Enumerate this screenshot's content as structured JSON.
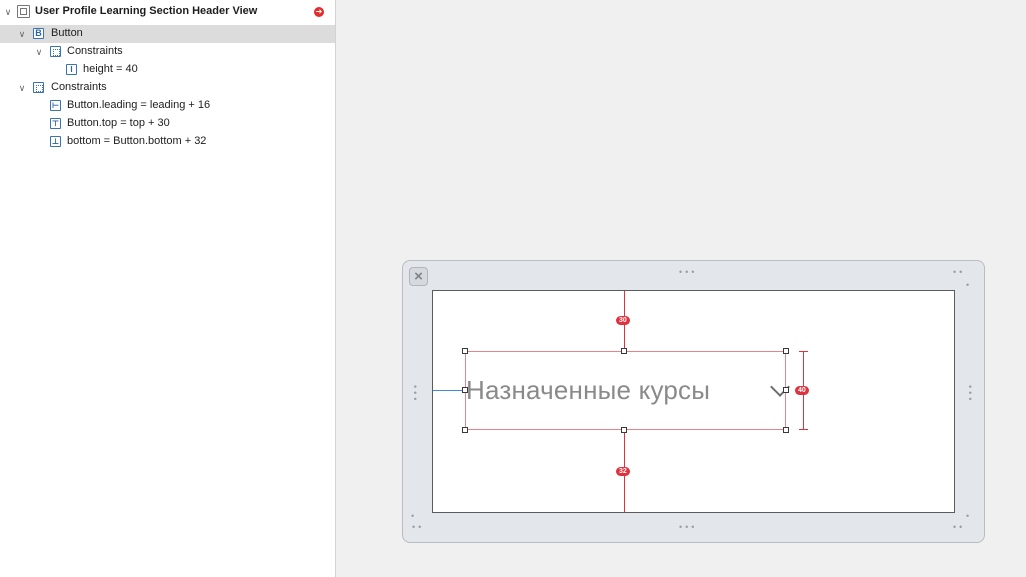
{
  "outline": {
    "root_label": "User Profile Learning Section Header View",
    "button_label": "Button",
    "button_icon_letter": "B",
    "button_constraints_label": "Constraints",
    "height_constraint": "height = 40",
    "constraints_label": "Constraints",
    "constraints": [
      "Button.leading = leading + 16",
      "Button.top = top + 30",
      "bottom = Button.bottom + 32"
    ],
    "error_indicator_color": "#e32b2b"
  },
  "canvas": {
    "button_title": "Назначенные курсы",
    "top_constant": "30",
    "bottom_constant": "32",
    "height_constant": "40",
    "constraint_color": "#e0323e",
    "leading_guide_color": "#3d8ed6"
  }
}
